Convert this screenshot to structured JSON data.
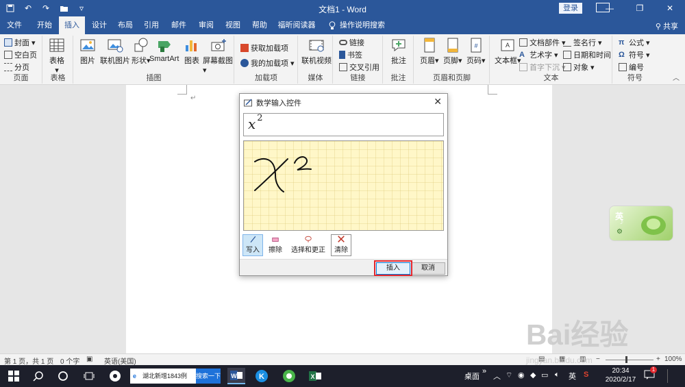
{
  "window": {
    "title": "文档1 - Word",
    "login_label": "登录"
  },
  "tabs": [
    {
      "label": "文件",
      "active": false
    },
    {
      "label": "开始",
      "active": false
    },
    {
      "label": "插入",
      "active": true
    },
    {
      "label": "设计",
      "active": false
    },
    {
      "label": "布局",
      "active": false
    },
    {
      "label": "引用",
      "active": false
    },
    {
      "label": "邮件",
      "active": false
    },
    {
      "label": "审阅",
      "active": false
    },
    {
      "label": "视图",
      "active": false
    },
    {
      "label": "帮助",
      "active": false
    },
    {
      "label": "福昕阅读器",
      "active": false
    },
    {
      "label": "操作说明搜索",
      "active": false
    }
  ],
  "share_label": "共享",
  "ribbon": {
    "pages": {
      "label": "页面",
      "cover": "封面",
      "blank": "空白页",
      "break": "分页"
    },
    "table": {
      "label": "表格",
      "btn": "表格"
    },
    "illustrations": {
      "label": "插图",
      "picture": "图片",
      "online_picture": "联机图片",
      "shapes": "形状",
      "smartart": "SmartArt",
      "chart": "图表",
      "screenshot": "屏幕截图"
    },
    "addins": {
      "label": "加载项",
      "get": "获取加载项",
      "my": "我的加载项"
    },
    "media": {
      "label": "媒体",
      "online_video": "联机视频"
    },
    "links": {
      "label": "链接",
      "link": "链接",
      "bookmark": "书签",
      "crossref": "交叉引用"
    },
    "comments": {
      "label": "批注",
      "comment": "批注"
    },
    "header_footer": {
      "label": "页眉和页脚",
      "header": "页眉",
      "footer": "页脚",
      "page_number": "页码"
    },
    "text": {
      "label": "文本",
      "textbox": "文本框",
      "parts": "文档部件",
      "wordart": "艺术字",
      "dropcap": "首字下沉",
      "signature": "签名行",
      "datetime": "日期和时间",
      "object": "对象"
    },
    "symbols": {
      "label": "符号",
      "equation": "公式",
      "symbol": "符号",
      "number": "编号"
    }
  },
  "dialog": {
    "title": "数学输入控件",
    "preview_base": "x",
    "preview_exp": "2",
    "tools": {
      "write": "写入",
      "erase": "擦除",
      "select_correct": "选择和更正",
      "clear": "清除"
    },
    "insert_label": "插入",
    "cancel_label": "取消"
  },
  "ime_label": "英",
  "status": {
    "page": "第 1 页，共 1 页",
    "words": "0 个字",
    "language": "英语(美国)",
    "zoom": "100%"
  },
  "taskbar": {
    "search_text": "湖北新增1843例",
    "search_btn": "搜索一下",
    "desktop": "桌面",
    "ime": "英",
    "time": "20:34",
    "date": "2020/2/17",
    "notification_count": "1"
  },
  "watermark": {
    "brand": "Bai经验",
    "url": "jingyan.baidu.com"
  }
}
